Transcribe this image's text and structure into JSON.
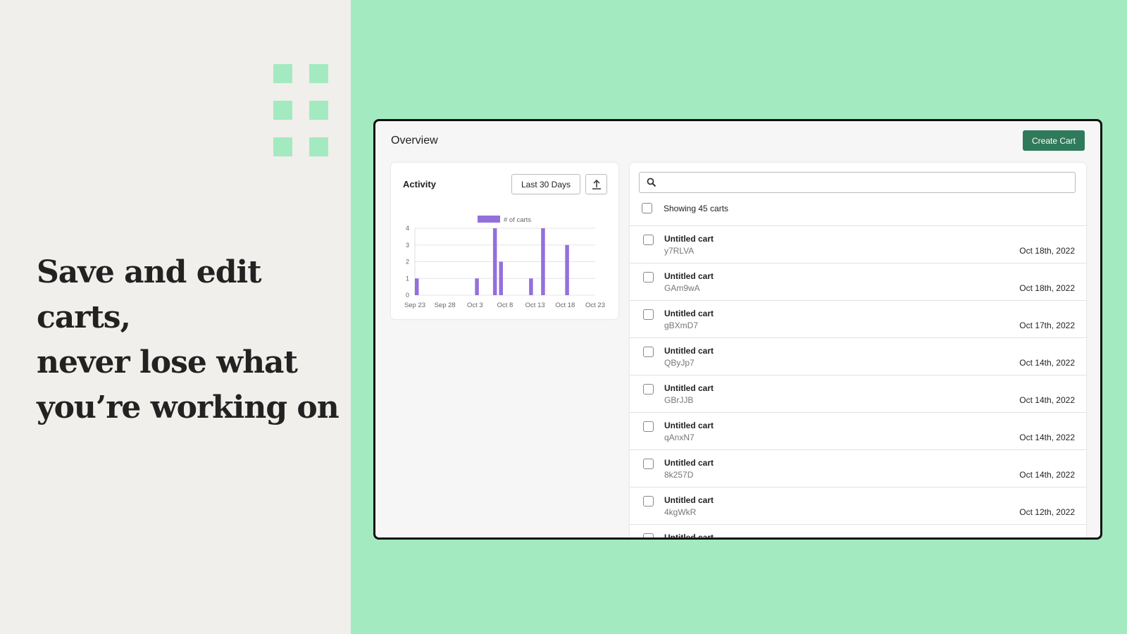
{
  "headline": {
    "lines": [
      "Save and edit carts,",
      "never lose what",
      "you’re working on"
    ]
  },
  "colors": {
    "accent_green": "#a3eac0",
    "button": "#2f7a5a",
    "bar": "#9370db"
  },
  "app": {
    "title": "Overview",
    "create_button": "Create Cart",
    "activity": {
      "title": "Activity",
      "range": "Last 30 Days",
      "export_icon": "upload-icon"
    },
    "search": {
      "placeholder": "",
      "icon": "search-icon"
    },
    "showing": "Showing 45 carts",
    "carts": [
      {
        "name": "Untitled cart",
        "id": "y7RLVA",
        "date": "Oct 18th, 2022"
      },
      {
        "name": "Untitled cart",
        "id": "GAm9wA",
        "date": "Oct 18th, 2022"
      },
      {
        "name": "Untitled cart",
        "id": "gBXmD7",
        "date": "Oct 17th, 2022"
      },
      {
        "name": "Untitled cart",
        "id": "QByJp7",
        "date": "Oct 14th, 2022"
      },
      {
        "name": "Untitled cart",
        "id": "GBrJJB",
        "date": "Oct 14th, 2022"
      },
      {
        "name": "Untitled cart",
        "id": "qAnxN7",
        "date": "Oct 14th, 2022"
      },
      {
        "name": "Untitled cart",
        "id": "8k257D",
        "date": "Oct 14th, 2022"
      },
      {
        "name": "Untitled cart",
        "id": "4kgWkR",
        "date": "Oct 12th, 2022"
      },
      {
        "name": "Untitled cart",
        "id": "",
        "date": ""
      }
    ]
  },
  "chart_data": {
    "type": "bar",
    "legend": "# of carts",
    "legend_position": "top",
    "grid": true,
    "xticks": [
      "Sep 23",
      "Sep 28",
      "Oct 3",
      "Oct 8",
      "Oct 13",
      "Oct 18",
      "Oct 23"
    ],
    "yticks": [
      0,
      1,
      2,
      3,
      4
    ],
    "ylim": [
      0,
      4
    ],
    "xlim": [
      "Sep 23",
      "Oct 23"
    ],
    "points": [
      {
        "x": "Sep 23",
        "y": 1
      },
      {
        "x": "Oct 3",
        "y": 1
      },
      {
        "x": "Oct 6",
        "y": 4
      },
      {
        "x": "Oct 7",
        "y": 2
      },
      {
        "x": "Oct 12",
        "y": 1
      },
      {
        "x": "Oct 14",
        "y": 4
      },
      {
        "x": "Oct 18",
        "y": 3
      }
    ]
  }
}
